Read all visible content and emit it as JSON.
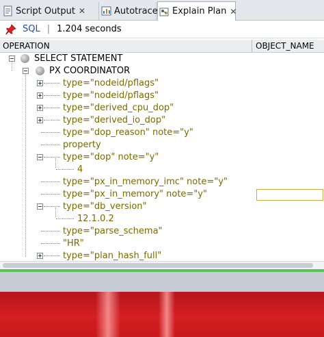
{
  "tabs": [
    {
      "label": "Script Output",
      "icon": "script-output-icon",
      "closable": true,
      "active": false
    },
    {
      "label": "Autotrace",
      "icon": "autotrace-icon",
      "closable": true,
      "active": false
    },
    {
      "label": "Explain Plan",
      "icon": "explain-plan-icon",
      "closable": true,
      "active": true
    }
  ],
  "close_glyph": "✕",
  "toolbar": {
    "pin_icon": "pin-icon",
    "sql_label": "SQL",
    "separator": "|",
    "elapsed": "1.204 seconds"
  },
  "columns": {
    "operation": "OPERATION",
    "object_name": "OBJECT_NAME"
  },
  "tree_rows": [
    "SELECT STATEMENT",
    "PX COORDINATOR",
    "type=\"nodeid/pflags\"",
    "type=\"nodeid/pflags\"",
    "type=\"derived_cpu_dop\"",
    "type=\"derived_io_dop\"",
    "type=\"dop_reason\" note=\"y\"",
    "property",
    "type=\"dop\" note=\"y\"",
    "4",
    "type=\"px_in_memory_imc\" note=\"y\"",
    "type=\"px_in_memory\" note=\"y\"",
    "type=\"db_version\"",
    "12.1.0.2",
    "type=\"parse_schema\"",
    "\"HR\"",
    "type=\"plan_hash_full\""
  ],
  "colors": {
    "attribute_text": "#7a6a00",
    "link": "#1a4fa3",
    "status_green": "#5cc35a",
    "background_red": "#d41e22"
  }
}
